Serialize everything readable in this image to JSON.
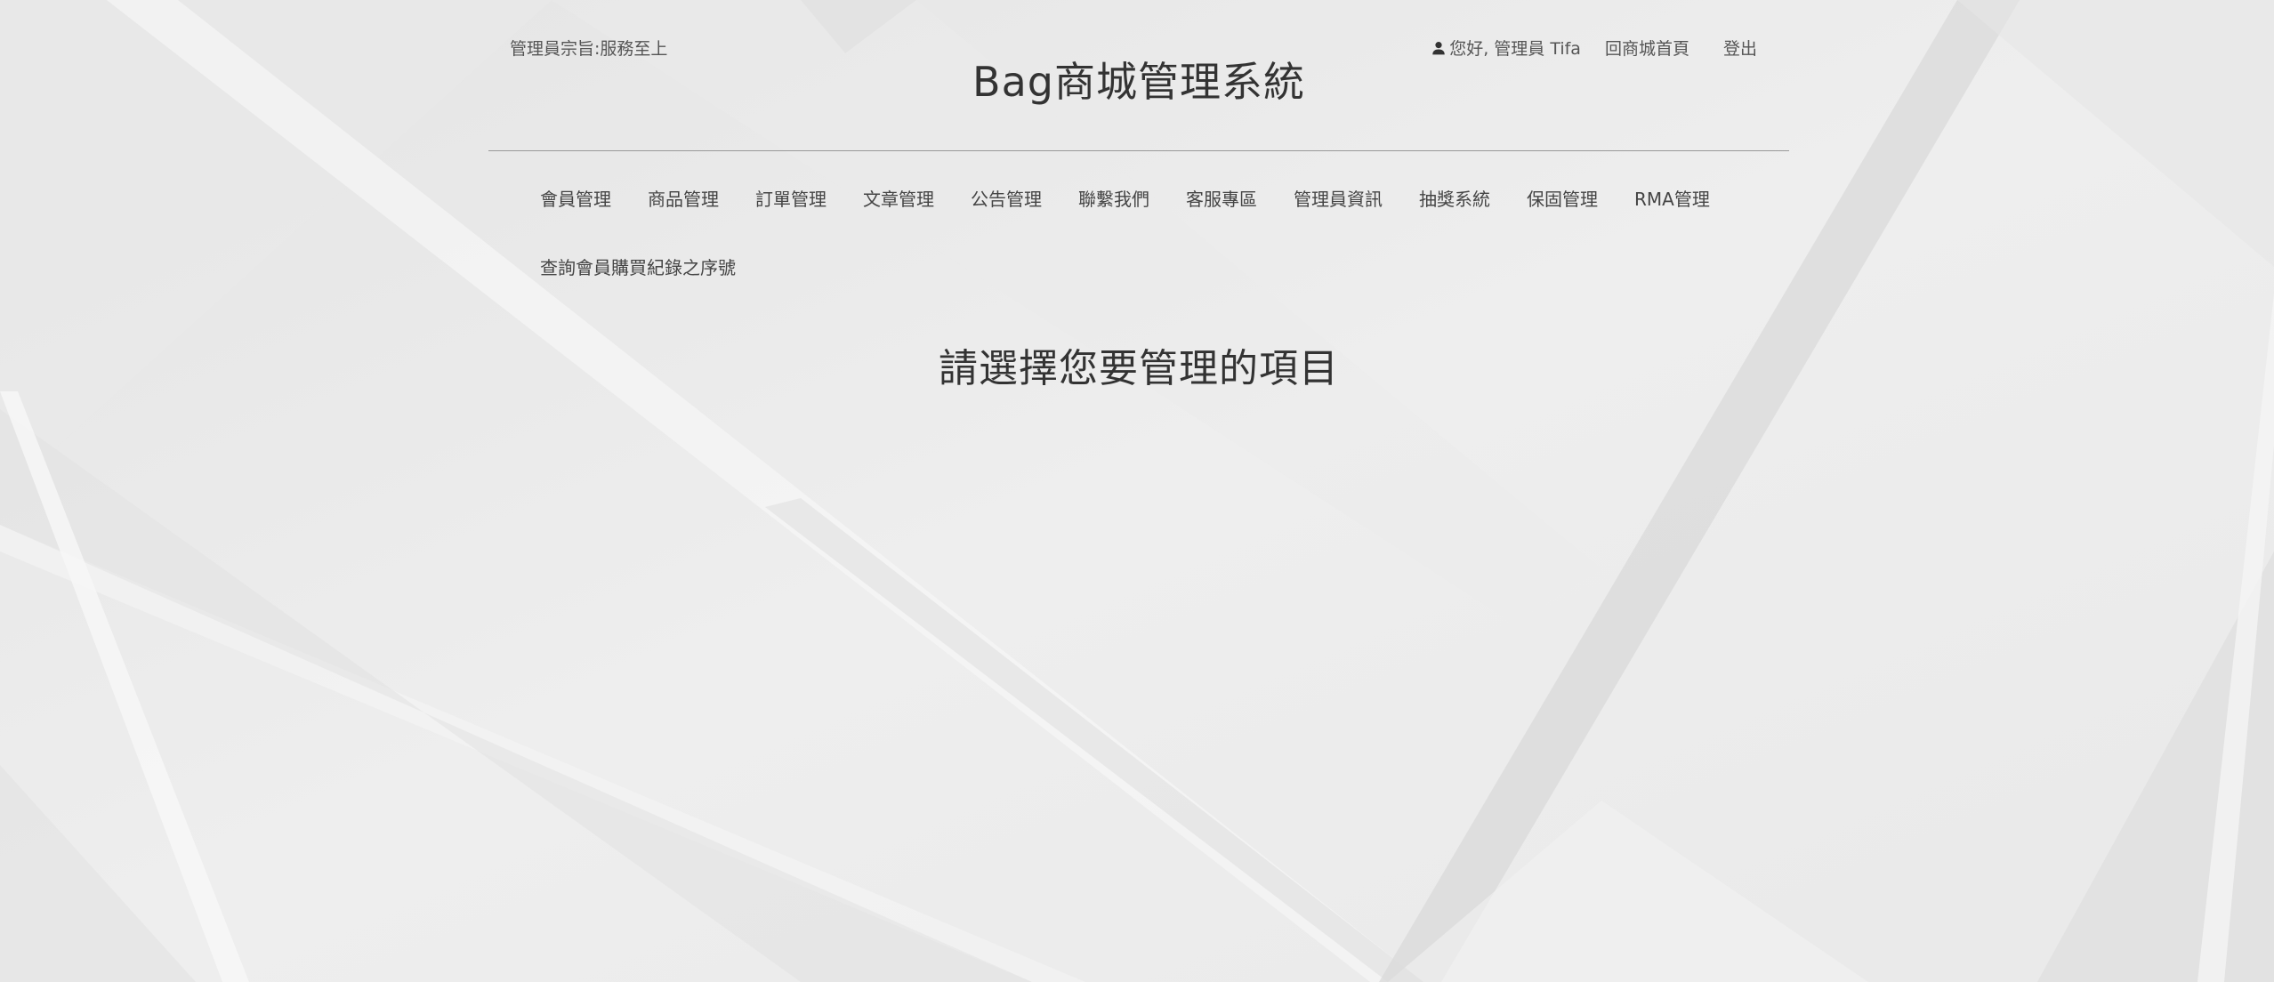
{
  "header": {
    "motto": "管理員宗旨:服務至上",
    "greeting": "您好, 管理員 Tifa",
    "user_icon": "user-icon",
    "home_link": "回商城首頁",
    "logout_link": "登出",
    "title": "Bag商城管理系統"
  },
  "nav": {
    "row1": [
      {
        "label": "會員管理"
      },
      {
        "label": "商品管理"
      },
      {
        "label": "訂單管理"
      },
      {
        "label": "文章管理"
      },
      {
        "label": "公告管理"
      },
      {
        "label": "聯繫我們"
      },
      {
        "label": "客服專區"
      },
      {
        "label": "管理員資訊"
      },
      {
        "label": "抽獎系統"
      },
      {
        "label": "保固管理"
      },
      {
        "label": "RMA管理"
      }
    ],
    "row2": [
      {
        "label": "查詢會員購買紀錄之序號"
      }
    ]
  },
  "main": {
    "heading": "請選擇您要管理的項目"
  },
  "colors": {
    "background": "#ececec",
    "text": "#333333",
    "divider": "#999999"
  }
}
